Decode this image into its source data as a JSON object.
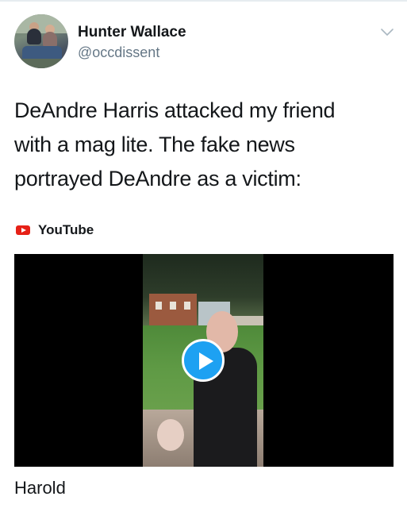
{
  "tweet": {
    "author_name": "Hunter Wallace",
    "author_handle": "@occdissent",
    "text_lines": [
      "DeAndre Harris attacked my friend",
      "with a mag lite. The fake news",
      "portrayed DeAndre as a victim:"
    ]
  },
  "card": {
    "source_label": "YouTube",
    "video_title": "Harold"
  },
  "icons": {
    "menu": "chevron-down-icon",
    "source": "youtube-icon",
    "play": "play-icon"
  },
  "colors": {
    "accent": "#1da1f2",
    "youtube_red": "#e62117",
    "text": "#14171a",
    "secondary_text": "#657786"
  }
}
